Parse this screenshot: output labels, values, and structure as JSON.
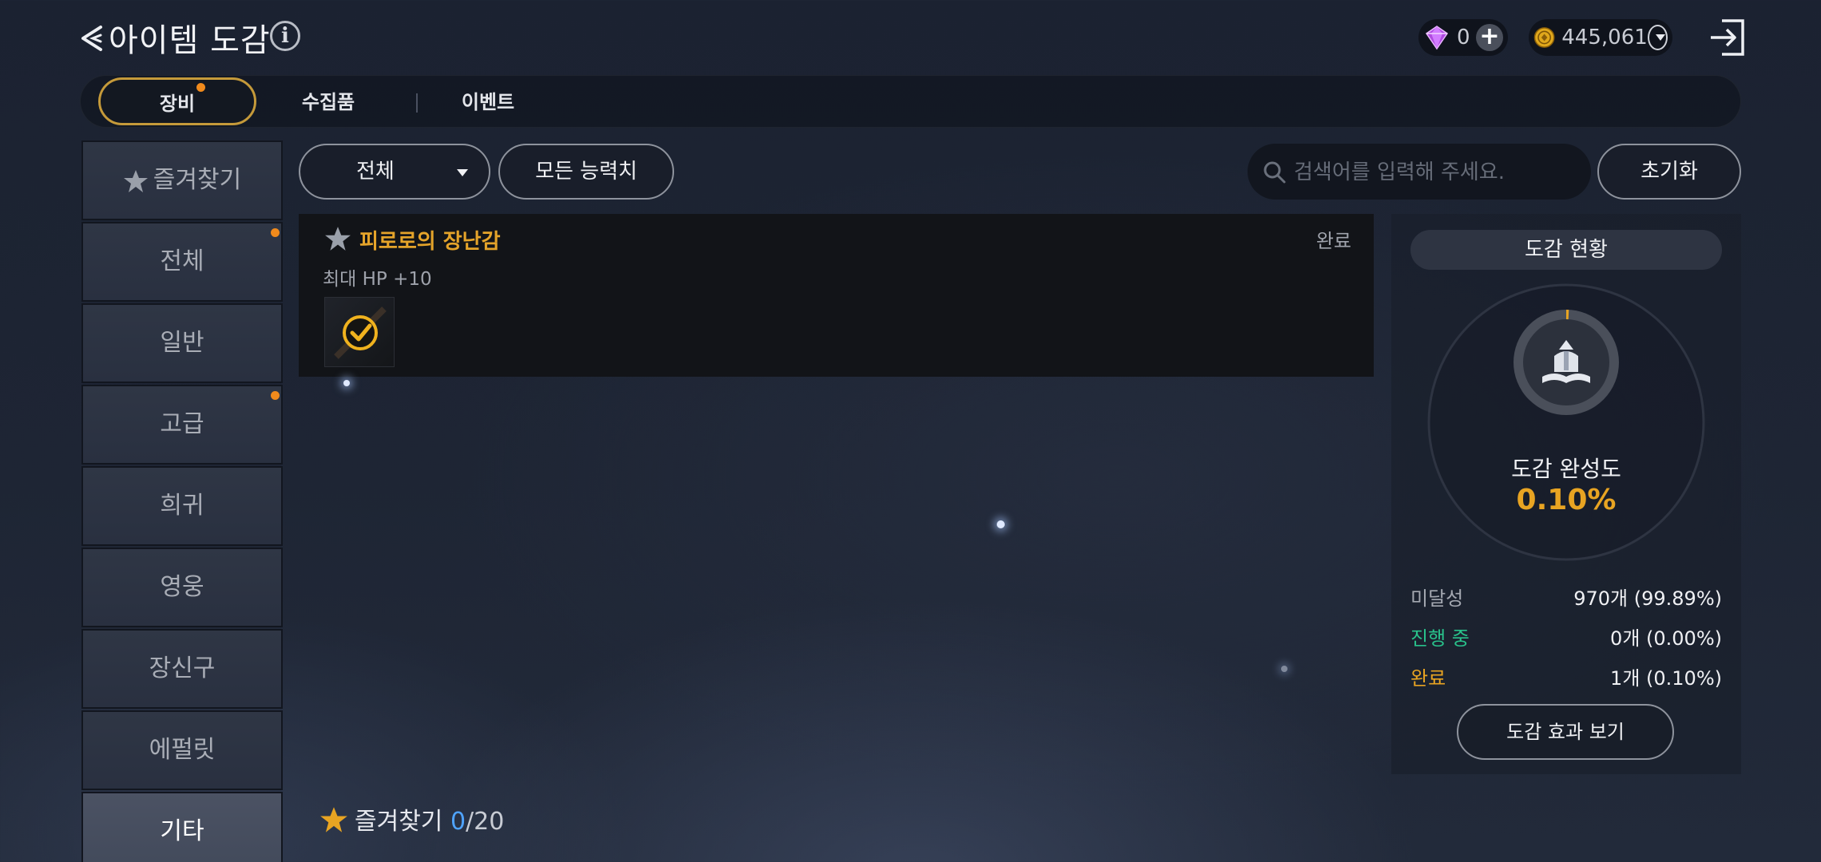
{
  "header": {
    "title": "아이템 도감",
    "gem_amount": "0",
    "gold_amount": "445,061"
  },
  "tabs": [
    {
      "label": "장비",
      "active": true,
      "has_badge": true
    },
    {
      "label": "수집품",
      "active": false,
      "has_badge": false
    },
    {
      "label": "이벤트",
      "active": false,
      "has_badge": false
    }
  ],
  "sidebar": {
    "items": [
      {
        "label": "즐겨찾기",
        "selected": false,
        "has_badge": false
      },
      {
        "label": "전체",
        "selected": false,
        "has_badge": true
      },
      {
        "label": "일반",
        "selected": false,
        "has_badge": false
      },
      {
        "label": "고급",
        "selected": false,
        "has_badge": true
      },
      {
        "label": "희귀",
        "selected": false,
        "has_badge": false
      },
      {
        "label": "영웅",
        "selected": false,
        "has_badge": false
      },
      {
        "label": "장신구",
        "selected": false,
        "has_badge": false
      },
      {
        "label": "에펄릿",
        "selected": false,
        "has_badge": false
      },
      {
        "label": "기타",
        "selected": true,
        "has_badge": false
      }
    ]
  },
  "filters": {
    "category_label": "전체",
    "stats_label": "모든 능력치",
    "search_placeholder": "검색어를 입력해 주세요.",
    "reset_label": "초기화"
  },
  "entry": {
    "name": "피로로의 장난감",
    "status": "완료",
    "effect": "최대 HP +10",
    "item_completed": true
  },
  "panel": {
    "title": "도감 현황",
    "completion_label": "도감 완성도",
    "completion_value": "0.10%",
    "completion_fraction": 0.001,
    "rows": [
      {
        "label": "미달성",
        "value": "970개 (99.89%)",
        "color": "#a4a8b1"
      },
      {
        "label": "진행 중",
        "value": "0개 (0.00%)",
        "color": "#29c28b"
      },
      {
        "label": "완료",
        "value": "1개 (0.10%)",
        "color": "#e8a422"
      }
    ],
    "effect_button": "도감 효과 보기"
  },
  "footer": {
    "label": "즐겨찾기",
    "current": "0",
    "total": "/20"
  },
  "colors": {
    "accent_gold": "#e8a422",
    "badge_orange": "#f08a1c",
    "progress_green": "#29c28b",
    "count_blue": "#4fa3ff"
  },
  "icons": [
    "back-chevron-icon",
    "info-icon",
    "gem-icon",
    "plus-icon",
    "gold-coin-icon",
    "dropdown-icon",
    "exit-icon",
    "star-icon",
    "search-icon",
    "check-icon",
    "book-crest-icon"
  ]
}
